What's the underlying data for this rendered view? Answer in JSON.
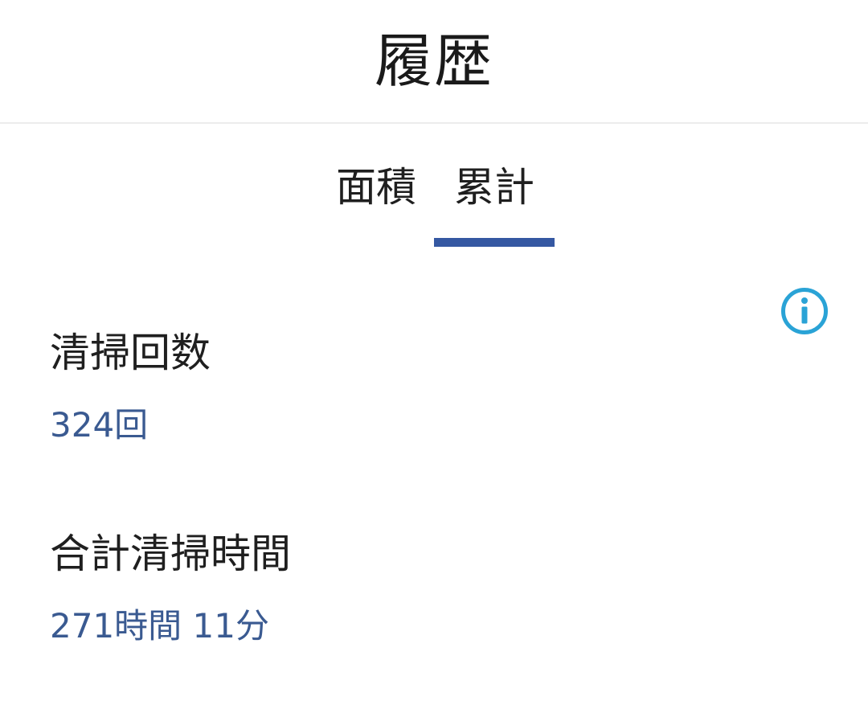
{
  "header": {
    "title": "履歴"
  },
  "tabs": [
    {
      "label": "面積",
      "selected": false
    },
    {
      "label": "累計",
      "selected": true
    }
  ],
  "info": {
    "icon": "info-circle-icon"
  },
  "stats": {
    "clean_count": {
      "label": "清掃回数",
      "value": "324回"
    },
    "total_time": {
      "label": "合計清掃時間",
      "value": "271時間 11分"
    }
  },
  "colors": {
    "accent": "#3558a2",
    "value_text": "#3a5a91",
    "info_icon": "#2aa3d6"
  }
}
